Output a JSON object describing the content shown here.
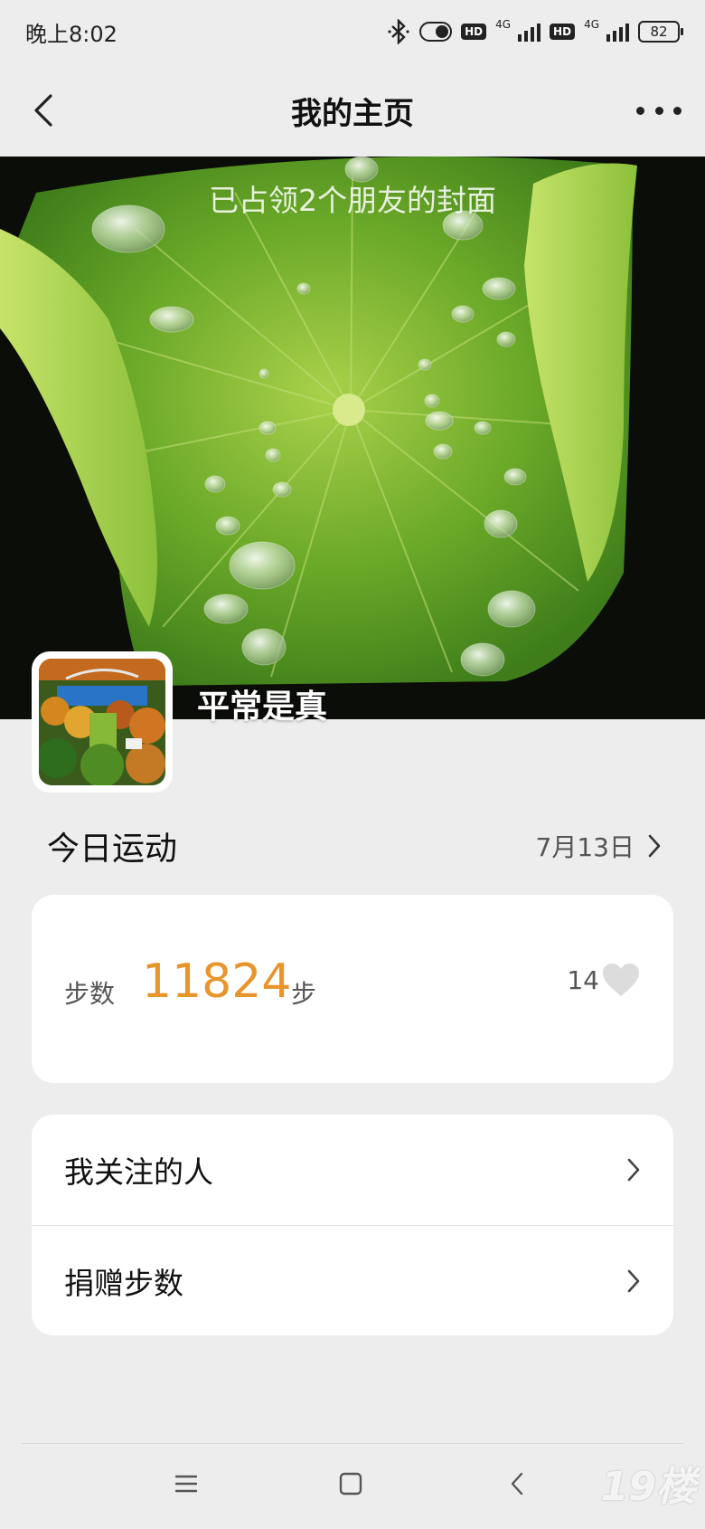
{
  "status_bar": {
    "time": "晚上8:02",
    "network_1": "4G",
    "network_2": "4G",
    "hd_1": "HD",
    "hd_2": "HD",
    "battery": "82"
  },
  "nav": {
    "title": "我的主页"
  },
  "cover": {
    "caption": "已占领2个朋友的封面",
    "username": "平常是真"
  },
  "today": {
    "title": "今日运动",
    "date": "7月13日"
  },
  "steps": {
    "label": "步数",
    "value": "11824",
    "unit": "步",
    "likes": "14"
  },
  "menu": {
    "items": [
      {
        "label": "我关注的人"
      },
      {
        "label": "捐赠步数"
      }
    ]
  },
  "watermark": "19楼",
  "colors": {
    "accent": "#e8952c",
    "background": "#ededed",
    "card": "#ffffff"
  }
}
